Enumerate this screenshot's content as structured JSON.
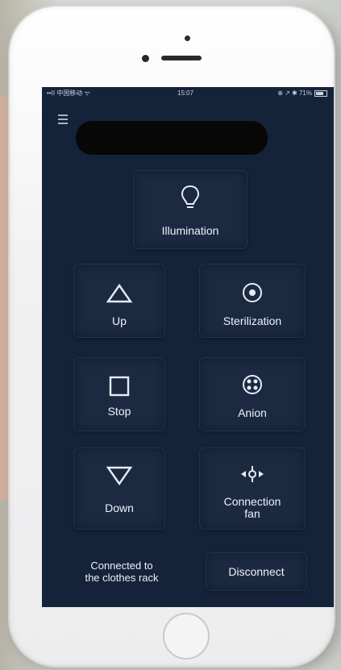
{
  "status_bar": {
    "carrier": "••II 中国移动 ᯤ",
    "time": "15:07",
    "right_icons": "⊕ ↗ ✱ 71%"
  },
  "controls": {
    "illumination": {
      "label": "Illumination",
      "icon": "lightbulb-icon"
    },
    "up": {
      "label": "Up",
      "icon": "triangle-up-icon"
    },
    "sterilization": {
      "label": "Sterilization",
      "icon": "target-circle-icon"
    },
    "stop": {
      "label": "Stop",
      "icon": "square-icon"
    },
    "anion": {
      "label": "Anion",
      "icon": "anion-icon"
    },
    "down": {
      "label": "Down",
      "icon": "triangle-down-icon"
    },
    "connection_fan": {
      "label_line1": "Connection",
      "label_line2": "fan",
      "icon": "fan-icon"
    }
  },
  "connection": {
    "status_line1": "Connected to",
    "status_line2": "the clothes rack",
    "disconnect_label": "Disconnect"
  },
  "colors": {
    "screen_background": "#15233a",
    "tile_background": "#1b2a41",
    "text": "#eef2f8"
  }
}
